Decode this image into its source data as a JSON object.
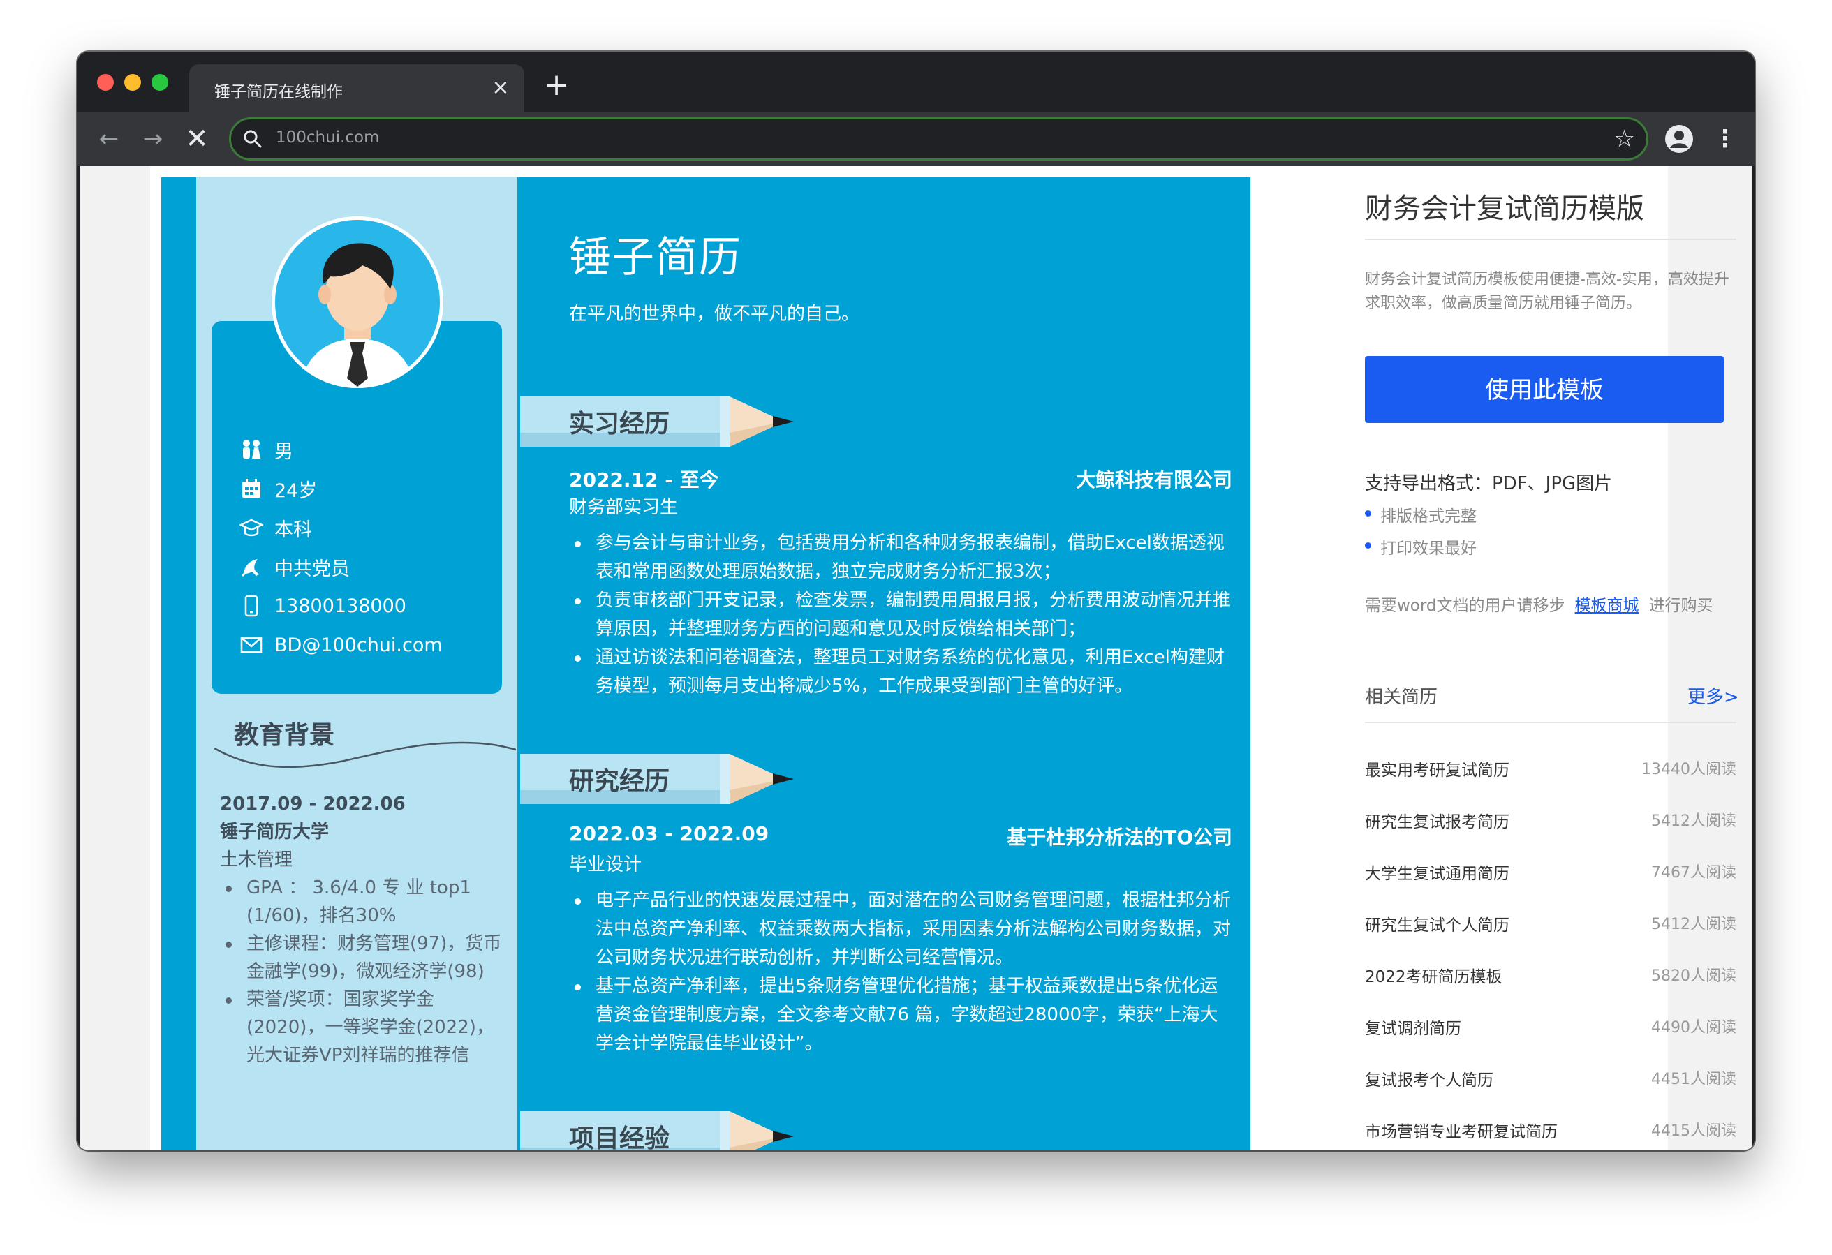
{
  "browser": {
    "tab_title": "锤子简历在线制作",
    "tab_close": "×",
    "tab_new": "+",
    "url": "100chui.com",
    "back": "←",
    "forward": "→",
    "stop": "✕",
    "star": "☆",
    "menu": "⋮"
  },
  "resume": {
    "name": "锤子简历",
    "motto": "在平凡的世界中，做不平凡的自己。",
    "info": [
      {
        "icon": "gender-icon",
        "text": "男"
      },
      {
        "icon": "calendar-icon",
        "text": "24岁"
      },
      {
        "icon": "graduation-cap-icon",
        "text": "本科"
      },
      {
        "icon": "party-member-icon",
        "text": "中共党员"
      },
      {
        "icon": "phone-icon",
        "text": "13800138000"
      },
      {
        "icon": "email-icon",
        "text": "BD@100chui.com"
      }
    ],
    "education": {
      "title": "教育背景",
      "period": "2017.09 - 2022.06",
      "school": "锤子简历大学",
      "major": "土木管理",
      "items": [
        "GPA ： 3.6/4.0 专 业 top1 (1/60)，排名30%",
        "主修课程：财务管理(97)，货币金融学(99)，微观经济学(98)",
        "荣誉/奖项：国家奖学金(2020)，一等奖学金(2022)，光大证券VP刘祥瑞的推荐信"
      ]
    },
    "internship": {
      "title": "实习经历",
      "period": "2022.12 - 至今",
      "company": "大鲸科技有限公司",
      "role": "财务部实习生",
      "items": [
        "参与会计与审计业务，包括费用分析和各种财务报表编制，借助Excel数据透视表和常用函数处理原始数据，独立完成财务分析汇报3次；",
        "负责审核部门开支记录，检查发票，编制费用周报月报，分析费用波动情况并推算原因，并整理财务方西的问题和意见及时反馈给相关部门；",
        "通过访谈法和问卷调查法，整理员工对财务系统的优化意见，利用Excel构建财务模型，预测每月支出将减少5%，工作成果受到部门主管的好评。"
      ]
    },
    "research": {
      "title": "研究经历",
      "period": "2022.03 - 2022.09",
      "company": "基于杜邦分析法的TO公司",
      "role": "毕业设计",
      "items": [
        "电子产品行业的快速发展过程中，面对潜在的公司财务管理问题，根据杜邦分析法中总资产净利率、权益乘数两大指标，采用因素分析法解构公司财务数据，对公司财务状况进行联动创析，并判断公司经营情况。",
        "基于总资产净利率，提出5条财务管理优化措施；基于权益乘数提出5条优化运营资金管理制度方案，全文参考文献76 篇，字数超过28000字，荣获“上海大学会计学院最佳毕业设计”。"
      ]
    },
    "project": {
      "title": "项目经验"
    }
  },
  "sidebar": {
    "title": "财务会计复试简历模版",
    "description": "财务会计复试简历模板使用便捷-高效-实用，高效提升求职效率，做高质量简历就用锤子简历。",
    "use_button": "使用此模板",
    "formats": "支持导出格式：PDF、JPG图片",
    "features": [
      "排版格式完整",
      "打印效果最好"
    ],
    "note_prefix": "需要word文档的用户请移步",
    "note_link": "模板商城",
    "note_suffix": "进行购买",
    "related_title": "相关简历",
    "more": "更多>",
    "related": [
      {
        "name": "最实用考研复试简历",
        "count": "13440人阅读"
      },
      {
        "name": "研究生复试报考简历",
        "count": "5412人阅读"
      },
      {
        "name": "大学生复试通用简历",
        "count": "7467人阅读"
      },
      {
        "name": "研究生复试个人简历",
        "count": "5412人阅读"
      },
      {
        "name": "2022考研简历模板",
        "count": "5820人阅读"
      },
      {
        "name": "复试调剂简历",
        "count": "4490人阅读"
      },
      {
        "name": "复试报考个人简历",
        "count": "4451人阅读"
      },
      {
        "name": "市场营销专业考研复试简历",
        "count": "4415人阅读"
      }
    ]
  }
}
